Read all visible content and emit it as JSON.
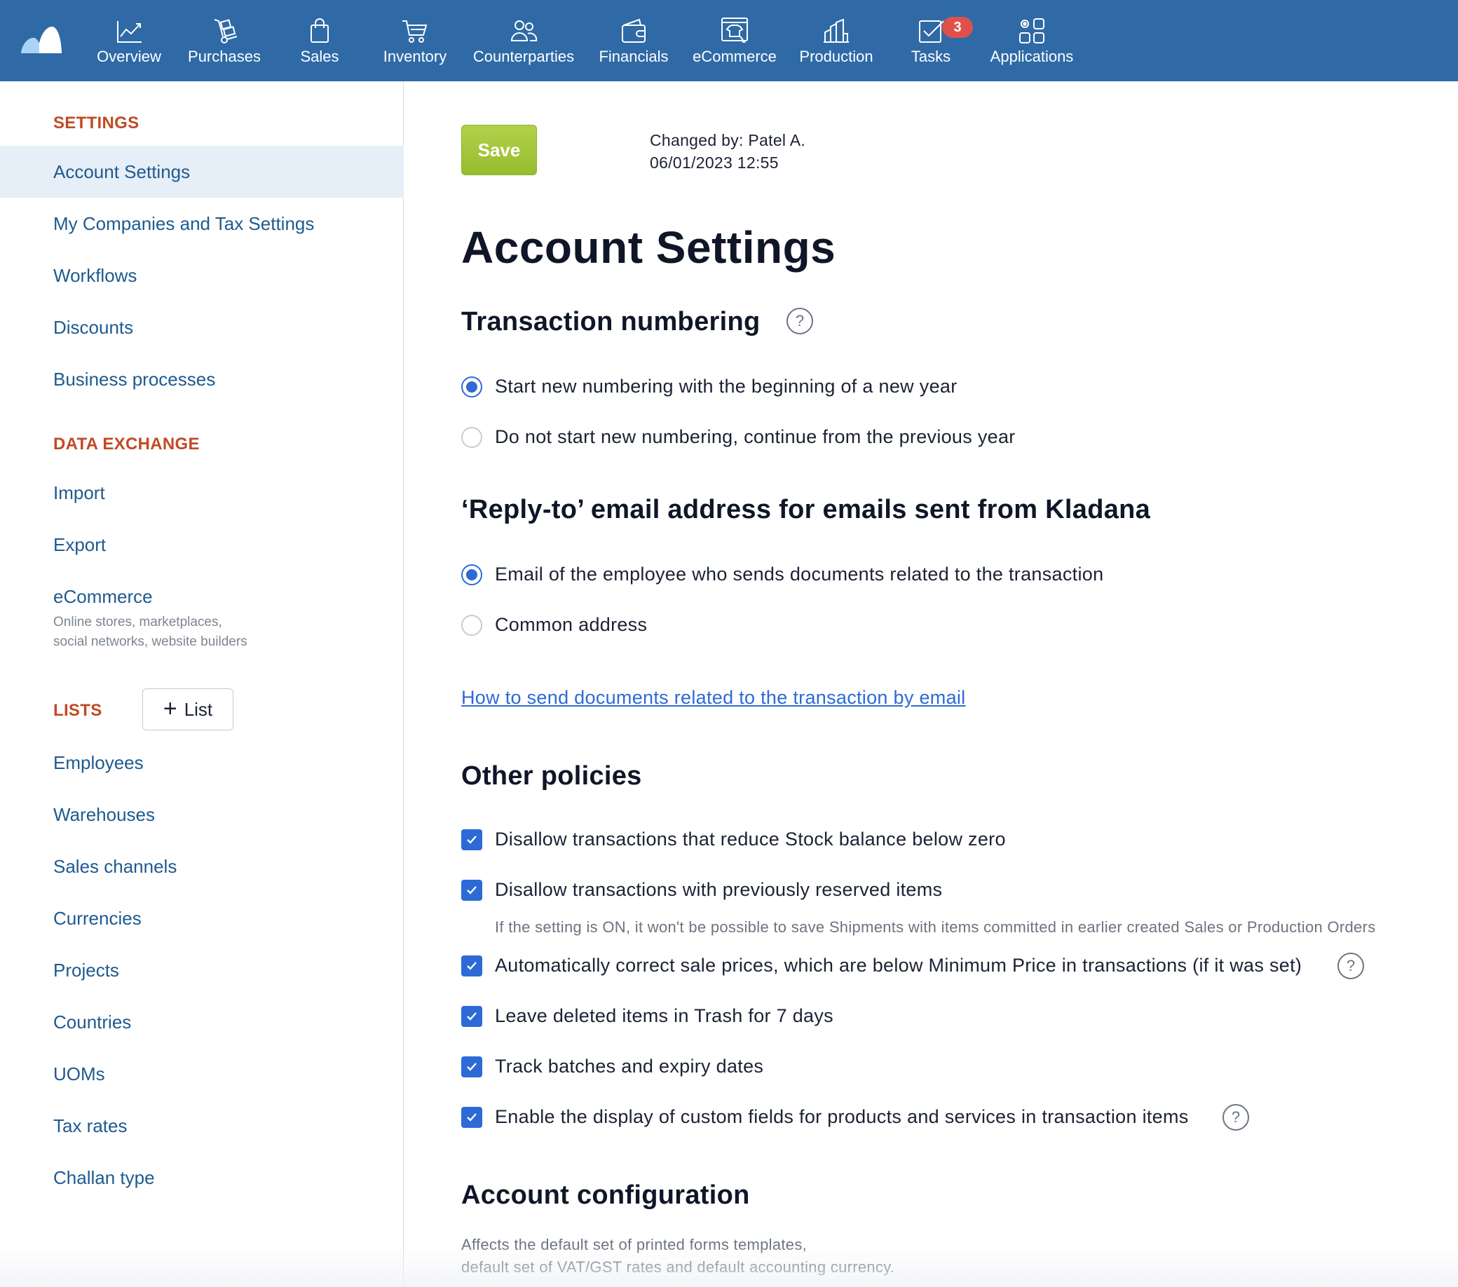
{
  "topnav": {
    "items": [
      {
        "label": "Overview",
        "icon": "chart-line-icon"
      },
      {
        "label": "Purchases",
        "icon": "hand-truck-icon"
      },
      {
        "label": "Sales",
        "icon": "shopping-bag-icon"
      },
      {
        "label": "Inventory",
        "icon": "cart-icon"
      },
      {
        "label": "Counterparties",
        "icon": "people-icon"
      },
      {
        "label": "Financials",
        "icon": "wallet-icon"
      },
      {
        "label": "eCommerce",
        "icon": "storefront-icon"
      },
      {
        "label": "Production",
        "icon": "factory-icon"
      },
      {
        "label": "Tasks",
        "icon": "checkbox-icon",
        "badge": "3"
      },
      {
        "label": "Applications",
        "icon": "apps-icon"
      }
    ]
  },
  "sidebar": {
    "settings_head": "SETTINGS",
    "settings_items": [
      "Account Settings",
      "My Companies and Tax Settings",
      "Workflows",
      "Discounts",
      "Business processes"
    ],
    "data_exchange_head": "DATA EXCHANGE",
    "data_exchange_items": [
      "Import",
      "Export",
      "eCommerce"
    ],
    "ecommerce_sub_1": "Online stores, marketplaces,",
    "ecommerce_sub_2": "social networks, website builders",
    "lists_head": "LISTS",
    "add_list_label": "List",
    "list_items": [
      "Employees",
      "Warehouses",
      "Sales channels",
      "Currencies",
      "Projects",
      "Countries",
      "UOMs",
      "Tax rates",
      "Challan type"
    ]
  },
  "main": {
    "save_label": "Save",
    "changed_by": "Changed by: Patel A.",
    "changed_at": "06/01/2023 12:55",
    "page_title": "Account Settings",
    "numbering_title": "Transaction numbering",
    "numbering_options": [
      {
        "label": "Start new numbering with the beginning of a new year",
        "selected": true
      },
      {
        "label": "Do not start new numbering, continue from the previous year",
        "selected": false
      }
    ],
    "reply_title": "‘Reply-to’ email address for emails sent from Kladana",
    "reply_options": [
      {
        "label": "Email of the employee who sends documents related to the transaction",
        "selected": true
      },
      {
        "label": "Common address",
        "selected": false
      }
    ],
    "help_link": "How to send documents related to the transaction by email",
    "policies_title": "Other policies",
    "policies": [
      {
        "label": "Disallow transactions that reduce Stock balance below zero",
        "checked": true
      },
      {
        "label": "Disallow transactions with previously reserved items",
        "checked": true,
        "hint": "If the setting is ON, it won't be possible to save Shipments with items committed in earlier created Sales or Production Orders"
      },
      {
        "label": "Automatically correct sale prices, which are below Minimum Price in transactions (if it was set)",
        "checked": true
      },
      {
        "label": "Leave deleted items in Trash for 7 days",
        "checked": true
      },
      {
        "label": "Track batches and expiry dates",
        "checked": true
      },
      {
        "label": "Enable the display of custom fields for products and services in transaction items",
        "checked": true
      }
    ],
    "config_title": "Account configuration",
    "config_desc_1": "Affects the default set of printed forms templates,",
    "config_desc_2": "default set of VAT/GST rates and default accounting currency."
  },
  "colors": {
    "topbar": "#2f6aa6",
    "accent_red": "#c14a24",
    "link_blue": "#1f5a8f",
    "control_blue": "#2d6ad6",
    "save_green": "#a4c83a",
    "badge_red": "#e0504b"
  }
}
